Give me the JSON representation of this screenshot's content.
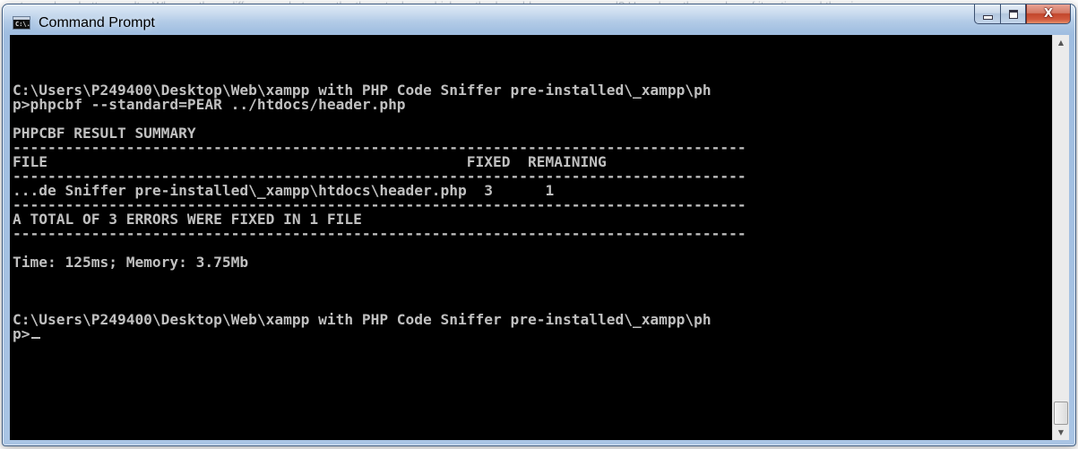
{
  "background_text": "... to produce better results. Why are there differences between the three tools ... which method would you recommend? How does the number of iteration and the size...",
  "window": {
    "title": "Command Prompt",
    "icon_label": "C:\\."
  },
  "console": {
    "lines": [
      "",
      "C:\\Users\\P249400\\Desktop\\Web\\xampp with PHP Code Sniffer pre-installed\\_xampp\\ph",
      "p>phpcbf --standard=PEAR ../htdocs/header.php",
      "",
      "PHPCBF RESULT SUMMARY",
      "------------------------------------------------------------------------------------",
      "FILE                                                FIXED  REMAINING",
      "------------------------------------------------------------------------------------",
      "...de Sniffer pre-installed\\_xampp\\htdocs\\header.php  3      1",
      "------------------------------------------------------------------------------------",
      "A TOTAL OF 3 ERRORS WERE FIXED IN 1 FILE",
      "------------------------------------------------------------------------------------",
      "",
      "Time: 125ms; Memory: 3.75Mb",
      "",
      "",
      "",
      "C:\\Users\\P249400\\Desktop\\Web\\xampp with PHP Code Sniffer pre-installed\\_xampp\\ph",
      "p>"
    ]
  },
  "colors": {
    "console_bg": "#000000",
    "console_text": "#c0c0c0",
    "close_button": "#c7432b"
  },
  "icons": {
    "minimize": "minimize-icon",
    "maximize": "maximize-icon",
    "close": "close-icon",
    "app": "cmd-icon"
  }
}
